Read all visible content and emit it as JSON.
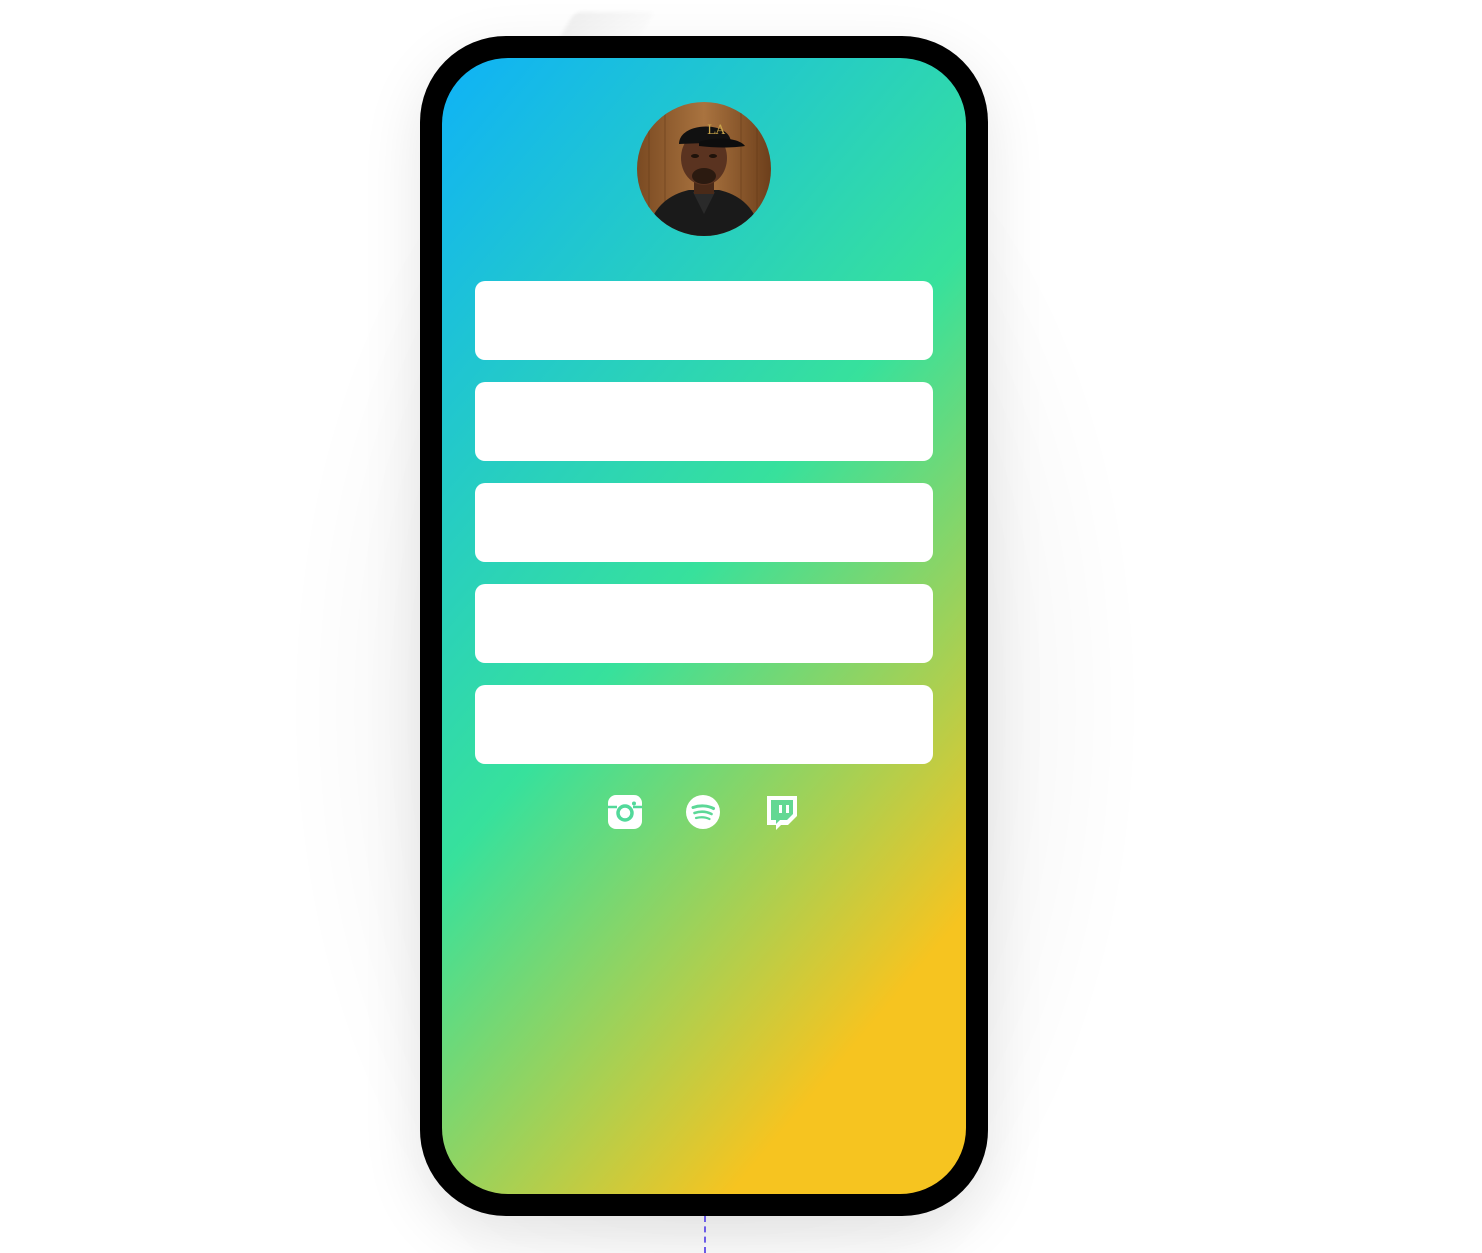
{
  "theme": {
    "gradient_start": "#0fb2f7",
    "gradient_mid": "#37e19c",
    "gradient_end": "#f6c420",
    "phone_frame": "#000000",
    "button_bg": "#ffffff",
    "icon_color": "#ffffff",
    "guide_line": "#6b5ce7"
  },
  "profile": {
    "avatar": "profile-photo"
  },
  "links": [
    {
      "label": ""
    },
    {
      "label": ""
    },
    {
      "label": ""
    },
    {
      "label": ""
    },
    {
      "label": ""
    }
  ],
  "social_icons": [
    {
      "icon": "instagram-icon"
    },
    {
      "icon": "spotify-icon"
    },
    {
      "icon": "twitch-icon"
    }
  ]
}
